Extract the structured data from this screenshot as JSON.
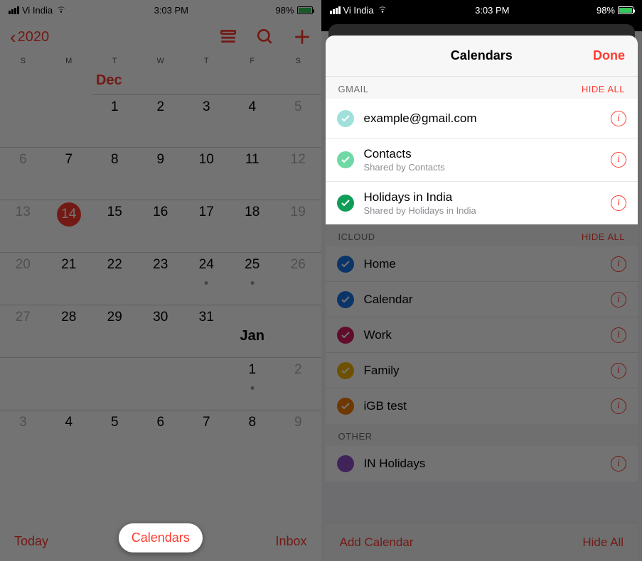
{
  "status": {
    "carrier": "Vi India",
    "time": "3:03 PM",
    "battery": "98%"
  },
  "left": {
    "back_year": "2020",
    "weekdays": [
      "S",
      "M",
      "T",
      "W",
      "T",
      "F",
      "S"
    ],
    "month1": "Dec",
    "month2": "Jan",
    "bottom": {
      "today": "Today",
      "calendars": "Calendars",
      "inbox": "Inbox"
    }
  },
  "right": {
    "header": {
      "title": "Calendars",
      "done": "Done"
    },
    "gmail": {
      "label": "GMAIL",
      "hide": "HIDE ALL",
      "items": [
        {
          "name": "example@gmail.com",
          "sub": "",
          "color": "#9fe0db"
        },
        {
          "name": "Contacts",
          "sub": "Shared by Contacts",
          "color": "#6fd9a6"
        },
        {
          "name": "Holidays in India",
          "sub": "Shared by Holidays in India",
          "color": "#0f9d58"
        }
      ]
    },
    "icloud": {
      "label": "ICLOUD",
      "hide": "HIDE ALL",
      "items": [
        {
          "name": "Home",
          "color": "#1a73e8"
        },
        {
          "name": "Calendar",
          "color": "#1a73e8"
        },
        {
          "name": "Work",
          "color": "#d81b60"
        },
        {
          "name": "Family",
          "color": "#f4b400"
        },
        {
          "name": "iGB test",
          "color": "#f57c00"
        }
      ]
    },
    "other": {
      "label": "OTHER",
      "items": [
        {
          "name": "IN Holidays",
          "color": "#8e4ec6"
        }
      ]
    },
    "bottom": {
      "add": "Add Calendar",
      "hide": "Hide All"
    }
  }
}
